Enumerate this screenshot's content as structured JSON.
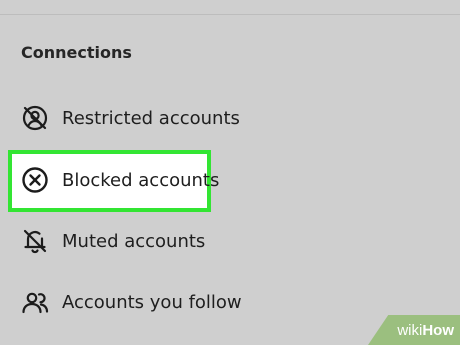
{
  "section": {
    "title": "Connections"
  },
  "items": [
    {
      "label": "Restricted accounts",
      "icon": "restricted-icon"
    },
    {
      "label": "Blocked accounts",
      "icon": "blocked-x-circle-icon",
      "highlighted": true
    },
    {
      "label": "Muted accounts",
      "icon": "muted-bell-icon"
    },
    {
      "label": "Accounts you follow",
      "icon": "people-icon"
    }
  ],
  "watermark": {
    "part1": "wiki",
    "part2": "How"
  },
  "colors": {
    "background": "#cfcfcf",
    "highlight_border": "#33e533",
    "highlight_fill": "#ffffff",
    "watermark_bg": "#9bbf7f"
  }
}
